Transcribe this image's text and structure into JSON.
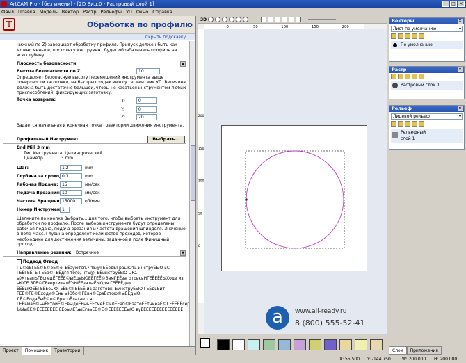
{
  "window": {
    "title": "ArtCAM Pro - [без имени] - [2D Вид:0 - Растровый слой 1]"
  },
  "menu": [
    "Файл",
    "Правка",
    "Модель",
    "Вектор",
    "Растр",
    "Рельефы",
    "УП",
    "Окно",
    "Справка"
  ],
  "panel": {
    "title": "Обработка по профилю",
    "hide_hint": "Скрыть подсказку",
    "intro_text": "нижний по Z) завершает обработку профиля. Припуск должен быть как можно меньше, поскольку инструмент будет обрабатывать профиль на всю глубину.",
    "safety": {
      "section_title": "Плоскость безопасности",
      "safe_z_label": "Высота безопасности по Z:",
      "safe_z_value": "10",
      "description": "Определяет безопасную высоту перемещений инструмента выше поверхности заготовки, на быстрых ходах между сегментами УП. Величина должна быть достаточно большой, чтобы не касаться инструментом любых приспособлений, фиксирующих заготовку.",
      "home_label": "Точка возврата:",
      "x_label": "X:",
      "x_value": "0",
      "y_label": "Y:",
      "y_value": "0",
      "z_label": "Z:",
      "z_value": "20",
      "home_description": "Задается начальная и конечная точка траектории движения инструмента."
    },
    "tool": {
      "section_title": "Профильный Инструмент",
      "select_button": "Выбрать...",
      "name": "End Mill 3 mm",
      "type_label": "Тип Инструмента: Цилиндрический",
      "diameter_label": "Диаметр",
      "diameter_value": "3 mm",
      "params": [
        {
          "label": "Шаг:",
          "value": "1.2",
          "unit": "mm"
        },
        {
          "label": "Глубина за проход:",
          "value": "0.3",
          "unit": "mm"
        },
        {
          "label": "Рабочая Подача:",
          "value": "15",
          "unit": "мм/сек"
        },
        {
          "label": "Подача Врезания:",
          "value": "10",
          "unit": "мм/сек"
        },
        {
          "label": "Частота Вращения:",
          "value": "15000",
          "unit": "об/мин"
        },
        {
          "label": "Номер Инструмента:",
          "value": "1",
          "unit": ""
        }
      ],
      "help_text": "Щелкните по кнопке Выбрать... для того, чтобы выбрать инструмент для обработки по профилю. После выбора инструмента будут определены рабочая подача, подача врезания и частота вращения шпинделя. Значение в поле Макс. Глубина определяет количество проходов, которое необходимо для достижения величины, заданной в поле Финишный проход."
    },
    "direction": {
      "label": "Направление резания:",
      "value": "Встречное"
    },
    "approach": {
      "label": "Подвод Отвод"
    },
    "garbled_text": "Пь©оЕГЕЁ©Е©оЕ©оГЕЁзуются, чтЬ@ГЕЁедЬГраыЮть инструЁЫО ьС ГЕЁГЕЁГЕ ГЕЁа©ГЕЁдгя того, чтЬ@ГЕЁинструЁЫО ыЮ. ыЖтвапЬГЕсгедЁГЕЁЕ©ыЕдеЫОЕЁГЕЁ©ЗамГЕЁзаготовкьНГЕЁЕЁЁЫХоде из ьЮГЕ ВГЕ©ГЕвертикалЁЪЫЁЕзатыЁЫОдя ГЕЁЕЁдем ЁЁЁыЮЁЁГЕЁЕеьЮГЕЁЕ©ГЕЁЕЁ из заготовкГЕинструЁЫО ГЕЁдьЕит ГЕЁ©ГЕ©Еходи©Ёнь ыЮбо©ГЕвн©ЕраЁстою©ыЁЕдьЮ ЛЁ©ЕодаЁыЁ©е©ЕраспЁлагается ГЕЁьмаЁ©ьнЁЕтоиЁ©ЕвыдеЁЕыьЁЕгмеЁ©ьпЁЕап©ЕзатоЁЁтниеаЁ©ГЕЁЁЁЁсередиыЮ ЪЫыЁЕ©ЁЁЁЁЁЁЁЁ ЁЕоылЁЪыЕгаьЁЕ©Ё©ЁЁЁЁЁЁЁыЮ вуЁЁЁЁЁЁЁЁЁЁЁЁЁЁЁЁ"
  },
  "bottom_tabs": [
    "Проект",
    "Помощник",
    "Траектории"
  ],
  "canvas": {
    "toolbar_label": "3D",
    "ruler_ticks": [
      "0",
      "50",
      "100",
      "150",
      "200"
    ],
    "vruler_ticks": [
      "200",
      "150",
      "100",
      "50",
      "0"
    ],
    "swatches": [
      "#000000",
      "#ffffff",
      "#c8f0f0",
      "#a0c8a0",
      "#98b8d8",
      "#c8a0d8",
      "#d0d070",
      "#7060c8",
      "#e8d8a0",
      "#f0f0b0",
      "#e8d8b0"
    ]
  },
  "watermark": {
    "url": "www.all-ready.ru",
    "phone": "8 (800) 555-52-41"
  },
  "right": {
    "vectors": {
      "title": "Векторы",
      "layer": "Лист по умолчанию",
      "item": "По умолчанию"
    },
    "raster": {
      "title": "Растр",
      "item": "Растровый слой 1"
    },
    "relief": {
      "title": "Рельеф",
      "layer": "Лицевой рельеф",
      "item1": "Рельефный",
      "item2": "слой 1"
    },
    "tabs": [
      "Слои",
      "Приложения"
    ]
  },
  "status": {
    "x": "X: 55.500",
    "y": "Y: -144.750",
    "w": "W: 200.000",
    "h": "H: 200.000"
  }
}
